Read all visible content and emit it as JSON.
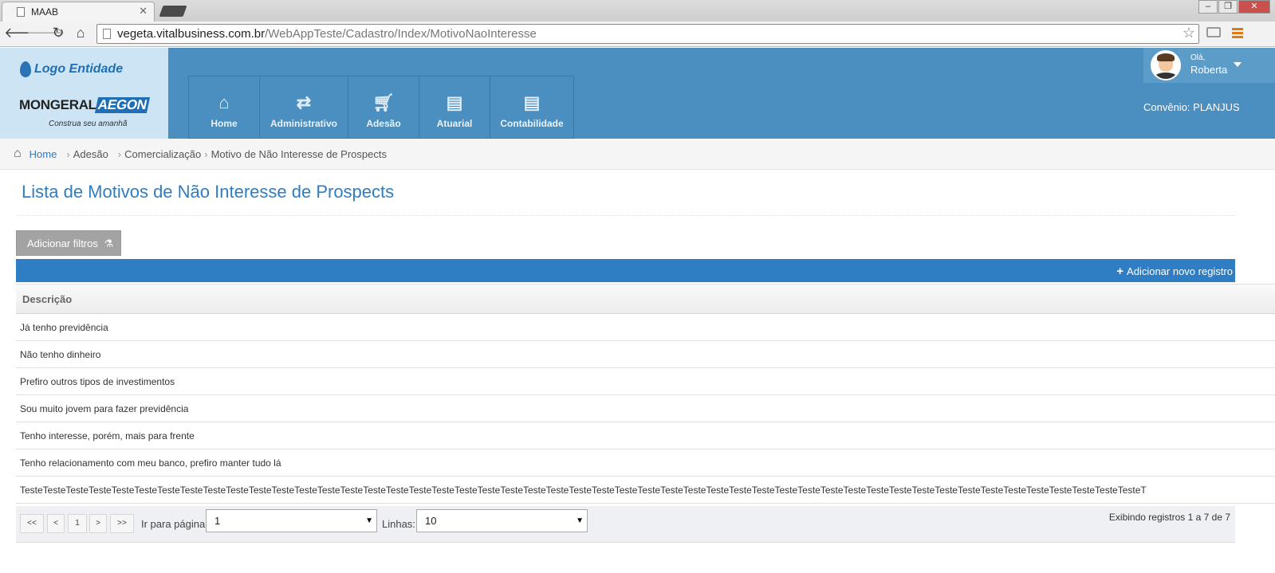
{
  "browser": {
    "tab_title": "MAAB",
    "url_host": "vegeta.vitalbusiness.com.br",
    "url_path": "/WebAppTeste/Cadastro/Index/MotivoNaoInteresse"
  },
  "header": {
    "logo_entidade": "Logo Entidade",
    "mongeral_left": "MONGERAL",
    "mongeral_right": "AEGON",
    "tagline": "Construa seu amanhã",
    "nav": [
      {
        "label": "Home",
        "icon": "home-icon"
      },
      {
        "label": "Administrativo",
        "icon": "retweet-icon"
      },
      {
        "label": "Adesão",
        "icon": "cart-icon"
      },
      {
        "label": "Atuarial",
        "icon": "book-icon"
      },
      {
        "label": "Contabilidade",
        "icon": "book-icon"
      }
    ],
    "user_greeting": "Olá,",
    "user_name": "Roberta",
    "convenio": "Convênio: PLANJUS"
  },
  "breadcrumb": {
    "home": "Home",
    "items": [
      "Adesão",
      "Comercialização",
      "Motivo de Não Interesse de Prospects"
    ]
  },
  "main": {
    "title": "Lista de Motivos de Não Interesse de Prospects",
    "filter_label": "Adicionar filtros",
    "add_label": "Adicionar novo registro",
    "column_header": "Descrição",
    "rows": [
      "Já tenho previdência",
      "Não tenho dinheiro",
      "Prefiro outros tipos de investimentos",
      "Sou muito jovem para fazer previdência",
      "Tenho interesse, porém, mais para frente",
      "Tenho relacionamento com meu banco, prefiro manter tudo lá",
      "TesteTesteTesteTesteTesteTesteTesteTesteTesteTesteTesteTesteTesteTesteTesteTesteTesteTesteTesteTesteTesteTesteTesteTesteTesteTesteTesteTesteTesteTesteTesteTesteTesteTesteTesteTesteTesteTesteTesteTesteTesteTesteTesteTesteTesteTesteTesteTesteTesteT"
    ]
  },
  "pager": {
    "first": "<<",
    "prev": "<",
    "page": "1",
    "next": ">",
    "last": ">>",
    "goto_label": "Ir para página:",
    "goto_value": "1",
    "lines_label": "Linhas:",
    "lines_value": "10",
    "summary": "Exibindo registros 1 a 7 de 7"
  }
}
